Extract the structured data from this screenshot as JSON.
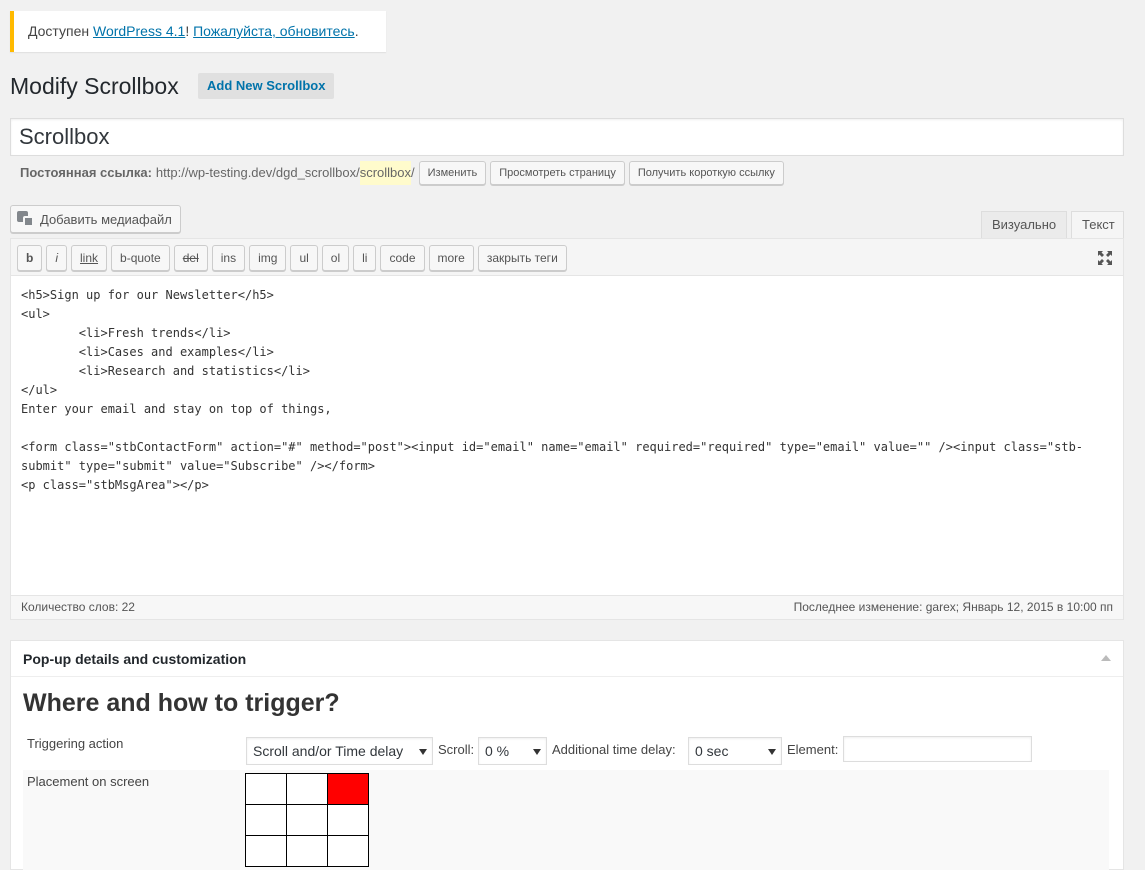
{
  "notice": {
    "prefix": "Доступен ",
    "version_link": "WordPress 4.1",
    "separator": "! ",
    "update_link": "Пожалуйста, обновитесь",
    "suffix": "."
  },
  "header": {
    "title": "Modify Scrollbox",
    "add_new": "Add New Scrollbox"
  },
  "post_title": "Scrollbox",
  "permalink": {
    "label": "Постоянная ссылка:",
    "url_base": "http://wp-testing.dev/dgd_scrollbox/",
    "slug": "scrollbox",
    "trailing": "/",
    "edit_btn": "Изменить",
    "view_btn": "Просмотреть страницу",
    "shortlink_btn": "Получить короткую ссылку"
  },
  "media_button": "Добавить медиафайл",
  "editor_tabs": {
    "visual": "Визуально",
    "text": "Текст"
  },
  "quicktags": [
    "b",
    "i",
    "link",
    "b-quote",
    "del",
    "ins",
    "img",
    "ul",
    "ol",
    "li",
    "code",
    "more",
    "закрыть теги"
  ],
  "editor_content": "<h5>Sign up for our Newsletter</h5>\n<ul>\n\t<li>Fresh trends</li>\n\t<li>Cases and examples</li>\n\t<li>Research and statistics</li>\n</ul>\nEnter your email and stay on top of things,\n\n<form class=\"stbContactForm\" action=\"#\" method=\"post\"><input id=\"email\" name=\"email\" required=\"required\" type=\"email\" value=\"\" /><input class=\"stb-submit\" type=\"submit\" value=\"Subscribe\" /></form>\n<p class=\"stbMsgArea\"></p>",
  "status": {
    "word_count": "Количество слов: 22",
    "last_edited": "Последнее изменение: garex; Январь 12, 2015 в 10:00 пп"
  },
  "metabox": {
    "title": "Pop-up details and customization",
    "section_title": "Where and how to trigger?",
    "triggering_label": "Triggering action",
    "trigger_value": "Scroll and/or Time delay",
    "scroll_label": "Scroll:",
    "scroll_value": "0 %",
    "delay_label": "Additional time delay:",
    "delay_value": "0 sec",
    "element_label": "Element:",
    "placement_label": "Placement on screen",
    "placement_active_cell": 2
  },
  "colors": {
    "notice_border": "#ffba00",
    "link": "#0073aa",
    "placement_active": "#ff0000"
  }
}
